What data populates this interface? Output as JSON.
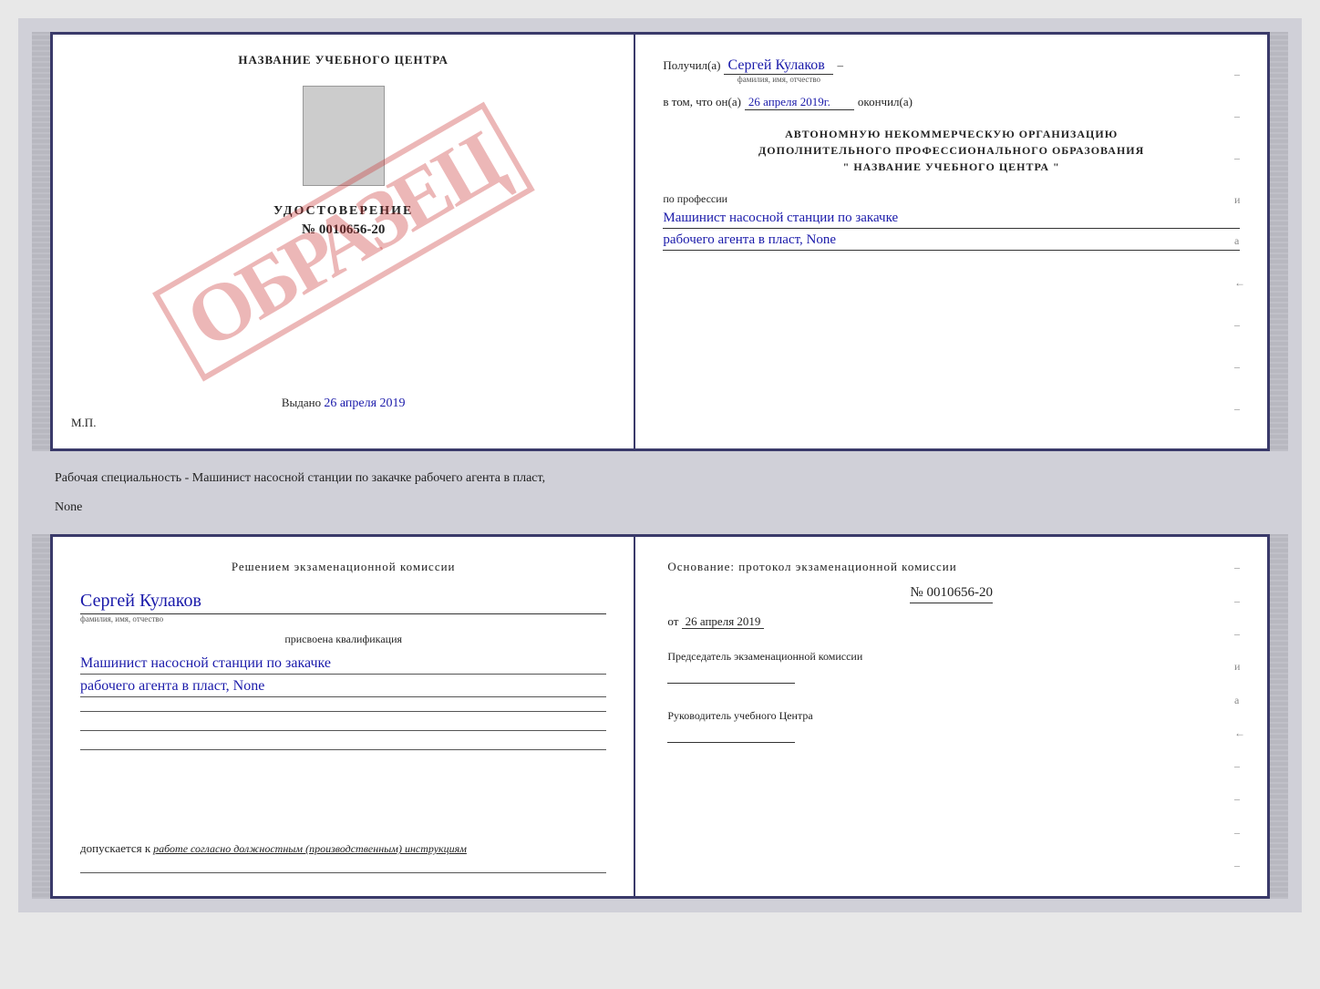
{
  "top_left": {
    "school_name": "НАЗВАНИЕ УЧЕБНОГО ЦЕНТРА",
    "watermark": "ОБРАЗЕЦ",
    "udostoverenie_title": "УДОСТОВЕРЕНИЕ",
    "udostoverenie_num": "№ 0010656-20",
    "vydano_label": "Выдано",
    "vydano_date": "26 апреля 2019",
    "mp_label": "М.П."
  },
  "top_right": {
    "poluchil_label": "Получил(а)",
    "poluchil_value": "Сергей Кулаков",
    "poluchil_subtext": "фамилия, имя, отчество",
    "vtom_label": "в том, что он(а)",
    "vtom_value": "26 апреля 2019г.",
    "okonchil_label": "окончил(а)",
    "org_line1": "АВТОНОМНУЮ НЕКОММЕРЧЕСКУЮ ОРГАНИЗАЦИЮ",
    "org_line2": "ДОПОЛНИТЕЛЬНОГО ПРОФЕССИОНАЛЬНОГО ОБРАЗОВАНИЯ",
    "org_line3": "\"  НАЗВАНИЕ УЧЕБНОГО ЦЕНТРА  \"",
    "po_professii": "по профессии",
    "profession_line1": "Машинист насосной станции по закачке",
    "profession_line2": "рабочего агента в пласт, None",
    "dashes": [
      "-",
      "-",
      "-",
      "и",
      "а",
      "←",
      "-",
      "-",
      "-"
    ]
  },
  "middle_text": "Рабочая специальность - Машинист насосной станции по закачке рабочего агента в пласт,",
  "middle_text2": "None",
  "bottom_left": {
    "resheniem_label": "Решением экзаменационной комиссии",
    "name_value": "Сергей Кулаков",
    "name_subtext": "фамилия, имя, отчество",
    "prisvoena_label": "присвоена квалификация",
    "qualification_line1": "Машинист насосной станции по закачке",
    "qualification_line2": "рабочего агента в пласт, None",
    "dopuskaetsya_label": "допускается к",
    "dopuskaetsya_value": "работе согласно должностным (производственным) инструкциям"
  },
  "bottom_right": {
    "osnovaniye_label": "Основание: протокол экзаменационной комиссии",
    "protocol_num": "№ 0010656-20",
    "ot_label": "от",
    "ot_date": "26 апреля 2019",
    "predsedatel_label": "Председатель экзаменационной комиссии",
    "rukovoditel_label": "Руководитель учебного Центра",
    "dashes": [
      "-",
      "-",
      "-",
      "и",
      "а",
      "←",
      "-",
      "-",
      "-",
      "-"
    ]
  }
}
